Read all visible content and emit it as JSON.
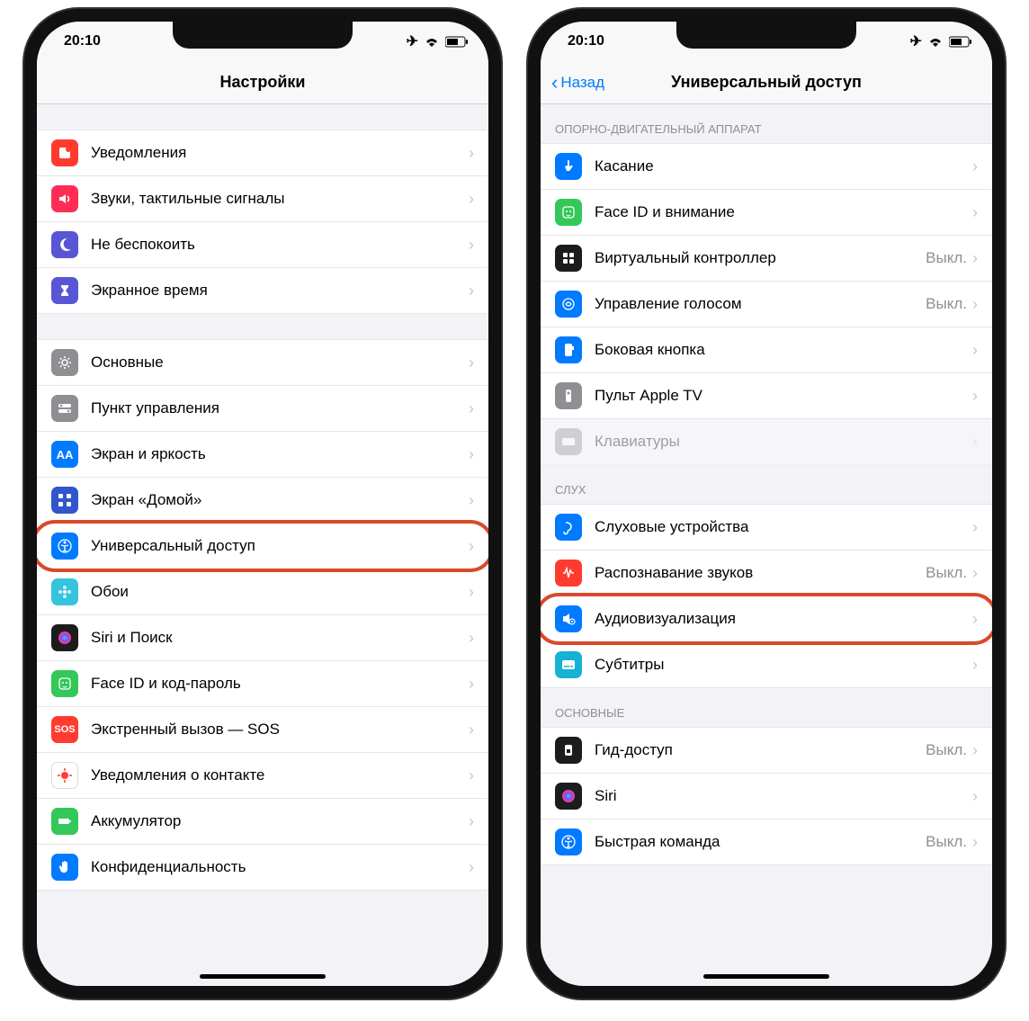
{
  "status": {
    "time": "20:10"
  },
  "left": {
    "nav_title": "Настройки",
    "groups": [
      {
        "rows": [
          {
            "key": "notifications",
            "label": "Уведомления",
            "icon": "notif-icon",
            "bg": "#ff3b30"
          },
          {
            "key": "sounds",
            "label": "Звуки, тактильные сигналы",
            "icon": "sound-icon",
            "bg": "#ff2d55"
          },
          {
            "key": "dnd",
            "label": "Не беспокоить",
            "icon": "moon-icon",
            "bg": "#5856d6"
          },
          {
            "key": "screentime",
            "label": "Экранное время",
            "icon": "hourglass-icon",
            "bg": "#5856d6"
          }
        ]
      },
      {
        "rows": [
          {
            "key": "general",
            "label": "Основные",
            "icon": "gear-icon",
            "bg": "#8e8e93"
          },
          {
            "key": "controlcenter",
            "label": "Пункт управления",
            "icon": "switch-icon",
            "bg": "#8e8e93"
          },
          {
            "key": "display",
            "label": "Экран и яркость",
            "icon": "aa-icon",
            "bg": "#007aff"
          },
          {
            "key": "homescreen",
            "label": "Экран «Домой»",
            "icon": "grid-icon",
            "bg": "#3355cc"
          },
          {
            "key": "accessibility",
            "label": "Универсальный доступ",
            "icon": "acc-icon",
            "bg": "#007aff",
            "highlight": true
          },
          {
            "key": "wallpaper",
            "label": "Обои",
            "icon": "flower-icon",
            "bg": "#35c4dc"
          },
          {
            "key": "siri",
            "label": "Siri и Поиск",
            "icon": "siri-icon",
            "bg": "#1c1c1e"
          },
          {
            "key": "faceid",
            "label": "Face ID и код-пароль",
            "icon": "face-icon",
            "bg": "#34c759"
          },
          {
            "key": "sos",
            "label": "Экстренный вызов — SOS",
            "icon": "sos-icon",
            "bg": "#ff3b30"
          },
          {
            "key": "exposure",
            "label": "Уведомления о контакте",
            "icon": "covid-icon",
            "bg": "#ffffff"
          },
          {
            "key": "battery",
            "label": "Аккумулятор",
            "icon": "battery-icon",
            "bg": "#34c759"
          },
          {
            "key": "privacy",
            "label": "Конфиденциальность",
            "icon": "hand-icon",
            "bg": "#007aff"
          }
        ]
      }
    ]
  },
  "right": {
    "nav_back": "Назад",
    "nav_title": "Универсальный доступ",
    "groups": [
      {
        "header": "ОПОРНО-ДВИГАТЕЛЬНЫЙ АППАРАТ",
        "rows": [
          {
            "key": "touch",
            "label": "Касание",
            "icon": "touch-icon",
            "bg": "#007aff"
          },
          {
            "key": "faceatt",
            "label": "Face ID и внимание",
            "icon": "face-icon",
            "bg": "#34c759"
          },
          {
            "key": "switchcontrol",
            "label": "Виртуальный контроллер",
            "value": "Выкл.",
            "icon": "switchctl-icon",
            "bg": "#1c1c1e"
          },
          {
            "key": "voicecontrol",
            "label": "Управление голосом",
            "value": "Выкл.",
            "icon": "voice-icon",
            "bg": "#007aff"
          },
          {
            "key": "sidebutton",
            "label": "Боковая кнопка",
            "icon": "side-icon",
            "bg": "#007aff"
          },
          {
            "key": "appletv",
            "label": "Пульт Apple TV",
            "icon": "remote-icon",
            "bg": "#8e8e93"
          },
          {
            "key": "keyboards",
            "label": "Клавиатуры",
            "icon": "kbd-icon",
            "bg": "#8e8e93",
            "faded": true
          }
        ]
      },
      {
        "header": "СЛУХ",
        "rows": [
          {
            "key": "hearing",
            "label": "Слуховые устройства",
            "icon": "ear-icon",
            "bg": "#007aff"
          },
          {
            "key": "soundrec",
            "label": "Распознавание звуков",
            "value": "Выкл.",
            "icon": "soundrec-icon",
            "bg": "#ff3b30"
          },
          {
            "key": "audiovisual",
            "label": "Аудиовизуализация",
            "icon": "av-icon",
            "bg": "#007aff",
            "highlight": true
          },
          {
            "key": "subtitles",
            "label": "Субтитры",
            "icon": "sub-icon",
            "bg": "#16b1d4"
          }
        ]
      },
      {
        "header": "ОСНОВНЫЕ",
        "rows": [
          {
            "key": "guided",
            "label": "Гид-доступ",
            "value": "Выкл.",
            "icon": "guided-icon",
            "bg": "#1c1c1e"
          },
          {
            "key": "siri2",
            "label": "Siri",
            "icon": "siri-icon",
            "bg": "#1c1c1e"
          },
          {
            "key": "shortcut",
            "label": "Быстрая команда",
            "value": "Выкл.",
            "icon": "shortcut-icon",
            "bg": "#007aff"
          }
        ]
      }
    ]
  },
  "value_off": "Выкл."
}
